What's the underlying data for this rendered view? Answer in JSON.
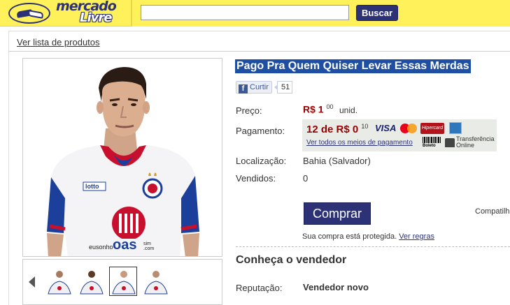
{
  "header": {
    "logo_line1": "mercado",
    "logo_line2": "Livre",
    "search_placeholder": "",
    "search_button": "Buscar",
    "brand_color": "#fff159",
    "accent_color": "#2d3277"
  },
  "breadcrumb": {
    "link": "Ver lista de produtos"
  },
  "product": {
    "title": "Pago Pra Quem Quiser Levar Essas Merdas",
    "facebook": {
      "like_label": "Curtir",
      "like_count": "51"
    },
    "price": {
      "label": "Preço:",
      "currency": "R$ 1",
      "cents": "00",
      "unit": "unid."
    },
    "payment": {
      "label": "Pagamento:",
      "installments": "12 de R$ 0",
      "installments_cents": "10",
      "methods_link": "Ver todos os meios de pagamento",
      "visa": "VISA",
      "hipercard": "Hipercard",
      "boleto": "Boleto",
      "transfer_line1": "Transferência",
      "transfer_line2": "Online"
    },
    "location": {
      "label": "Localização:",
      "value": "Bahia (Salvador)"
    },
    "sold": {
      "label": "Vendidos:",
      "value": "0"
    },
    "buy_button": "Comprar",
    "share_label": "Compatilh",
    "protected_text": "Sua compra está protegida.",
    "rules_link": "Ver regras"
  },
  "seller": {
    "heading": "Conheça o vendedor",
    "reputation_label": "Reputação:",
    "reputation_value": "Vendedor novo"
  },
  "gallery": {
    "shirt_sponsor_text": "eusonho",
    "shirt_sponsor_brand": "oas",
    "shirt_sponsor_suffix": "sim .com",
    "shirt_brand": "lotto",
    "thumbnails": 4,
    "selected_thumbnail": 3
  }
}
